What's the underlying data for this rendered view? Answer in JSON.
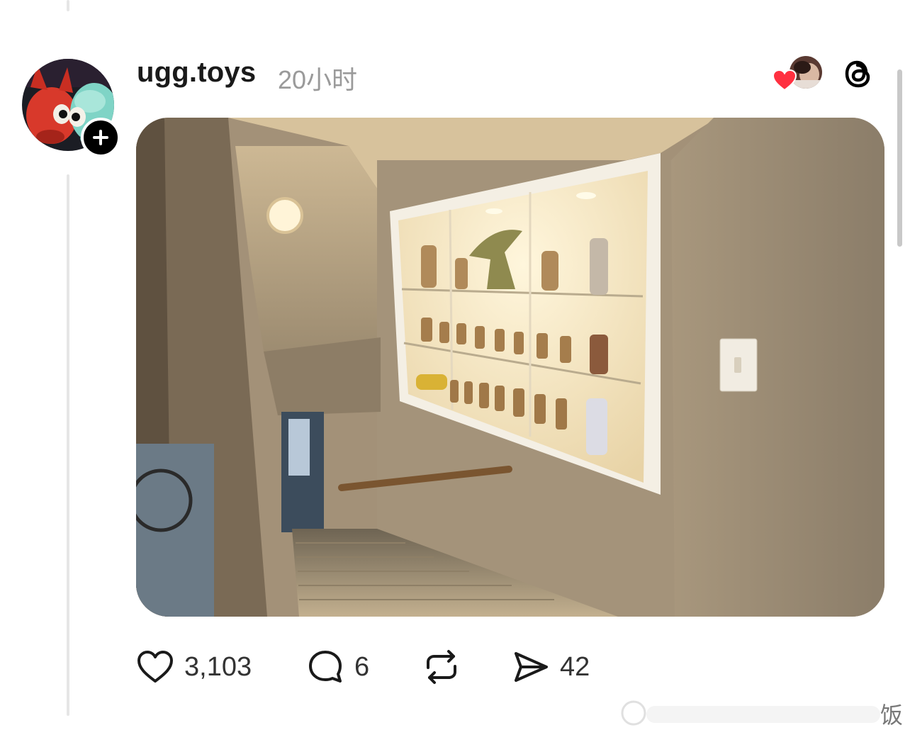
{
  "post": {
    "username": "ugg.toys",
    "timestamp": "20小时"
  },
  "actions": {
    "likes": "3,103",
    "replies": "6",
    "shares": "42"
  },
  "icons": {
    "like": "heart-icon",
    "reply": "reply-bubble-icon",
    "repost": "repost-icon",
    "share": "send-icon",
    "app": "threads-logo-icon",
    "follow": "plus-icon"
  },
  "colors": {
    "heart": "#ff3040",
    "text_primary": "#1a1a1a",
    "text_secondary": "#9a9a9a"
  },
  "watermark": {
    "text": "饭"
  }
}
